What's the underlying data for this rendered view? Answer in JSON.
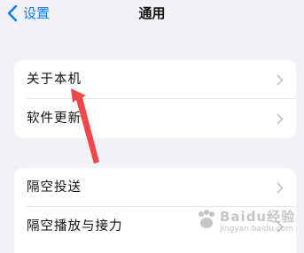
{
  "nav": {
    "back_label": "设置",
    "title": "通用"
  },
  "groups": [
    {
      "items": [
        {
          "label": "关于本机"
        },
        {
          "label": "软件更新"
        }
      ]
    },
    {
      "items": [
        {
          "label": "隔空投送"
        },
        {
          "label": "隔空播放与接力"
        }
      ]
    }
  ],
  "watermark": {
    "text": "Baidu经验",
    "sub": "jingyan.baidu.com"
  },
  "colors": {
    "accent": "#0a7aff",
    "background": "#f2f2f6",
    "arrow": "#f04848"
  }
}
